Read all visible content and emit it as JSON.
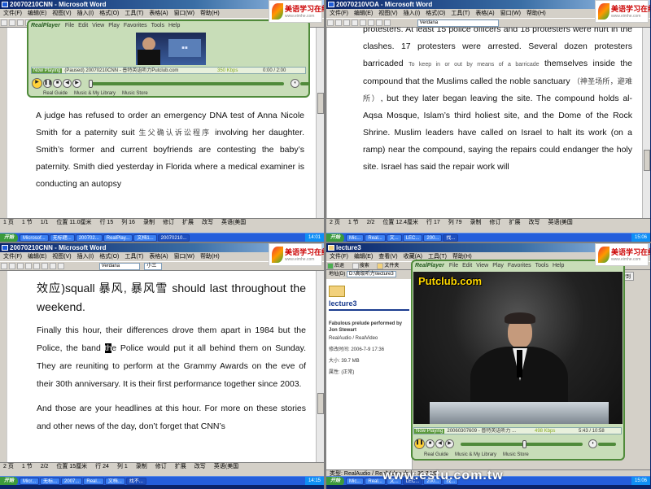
{
  "logo": {
    "text": "美语学习在线",
    "sub": "www.eimhe.com"
  },
  "windows": [
    {
      "title": "20070210CNN - Microsoft Word",
      "menus": [
        "文件(F)",
        "编辑(E)",
        "视图(V)",
        "插入(I)",
        "格式(O)",
        "工具(T)",
        "表格(A)",
        "窗口(W)",
        "帮助(H)"
      ],
      "player": {
        "brand": "RealPlayer",
        "menus": [
          "File",
          "Edit",
          "View",
          "Play",
          "Favorites",
          "Tools",
          "Help"
        ],
        "now_playing": "Now Playing",
        "clip": "(Paused) 20070210CNN - 普特英语听力Putclub.com",
        "bitrate": "350 Kbps",
        "time": "0:00 / 2:00",
        "progress_fraction": 0.0,
        "links": [
          "Real Guide",
          "Music & My Library",
          "Music Store"
        ]
      },
      "paragraphs": [
        "A judge has refused to order an emergency DNA test of Anna Nicole Smith for a paternity suit ",
        "生父确认诉讼程序",
        " involving her daughter. Smith’s former and current boyfriends are contesting the baby’s paternity. Smith died yesterday in Florida where a medical examiner is conducting an autopsy"
      ],
      "status": [
        "1 页",
        "1 节",
        "1/1",
        "位置 11.0厘米",
        "行 15",
        "列 16",
        "录制",
        "修订",
        "扩展",
        "改写",
        "英语(美国"
      ],
      "tasks": [
        "开始",
        "Microsof...",
        "无标题...",
        "200702...",
        "RealPlay...",
        "文档1...",
        "20070210..."
      ],
      "clock": "14:01"
    },
    {
      "title": "20070210VOA - Microsoft Word",
      "menus": [
        "文件(F)",
        "编辑(E)",
        "视图(V)",
        "插入(I)",
        "格式(O)",
        "工具(T)",
        "表格(A)",
        "窗口(W)",
        "帮助(H)"
      ],
      "font": "Verdana",
      "paragraphs": [
        "protesters. At least 15 police officers and 18 protesters were hurt in the clashes. 17 protesters were arrested. Several dozen protesters barricaded ",
        "To keep in or out by means of a barricade",
        " themselves inside the compound that the Muslims called the noble sanctuary ",
        "（神圣场所，避难所）",
        ", but they later began leaving the site. The compound holds al-Aqsa Mosque, Islam’s third holiest site, and the Dome of the Rock Shrine. Muslim leaders have called on Israel to halt its work (on a ramp) near the compound, saying the repairs could endanger the holy site. Israel has said the repair work will"
      ],
      "status": [
        "2 页",
        "1 节",
        "2/2",
        "位置 12.4厘米",
        "行 17",
        "列 79",
        "录制",
        "修订",
        "扩展",
        "改写",
        "英语(美国"
      ],
      "tasks": [
        "开始",
        "Mic...",
        "Real...",
        "文...",
        "LEC...",
        "200...",
        "找..."
      ],
      "clock": "15:06"
    },
    {
      "title": "20070210CNN - Microsoft Word",
      "menus": [
        "文件(F)",
        "编辑(E)",
        "视图(V)",
        "插入(I)",
        "格式(O)",
        "工具(T)",
        "表格(A)",
        "窗口(W)",
        "帮助(H)"
      ],
      "font": "Verdana",
      "size": "小三",
      "lines": [
        {
          "pre": "效应)squall 暴风, 暴风雪 should last throughout the weekend.",
          "big": true
        },
        {
          "pre": "Finally this hour, their differences drove them apart in 1984 but the Police, the band ",
          "sel": "th",
          "post": "e Police would put it all behind them on Sunday. They are reuniting to perform at the Grammy Awards on the eve of their 30th anniversary. It is their first performance together since 2003."
        },
        {
          "pre": "And those are your headlines at this hour. For more on these stories and other news of the day, don’t forget that CNN’s"
        }
      ],
      "status": [
        "2 页",
        "1 节",
        "2/2",
        "位置 15厘米",
        "行 24",
        "列 1",
        "录制",
        "修订",
        "扩展",
        "改写",
        "英语(美国"
      ],
      "tasks": [
        "开始",
        "Micr...",
        "无标...",
        "2007...",
        "Real...",
        "文档...",
        "找不..."
      ],
      "clock": "14:15"
    },
    {
      "title": "lecture3",
      "menus": [
        "文件(F)",
        "编辑(E)",
        "查看(V)",
        "收藏(A)",
        "工具(T)",
        "帮助(H)"
      ],
      "toolbar": [
        "后退",
        "搜索",
        "文件夹"
      ],
      "address_label": "地址(D)",
      "address": "D:\\高级听力\\lecture3",
      "go": "转到",
      "explorer": {
        "name": "lecture3",
        "desc": "Fabulous prelude performed by Jon Stewart",
        "type": "RealAudio / RealVideo",
        "modified": "修改时间: 2006-7-9 17:36",
        "size": "大小: 39.7 MB",
        "attr": "属性: (正常)"
      },
      "player": {
        "brand": "RealPlayer",
        "menus": [
          "File",
          "Edit",
          "View",
          "Play",
          "Favorites",
          "Tools",
          "Help"
        ],
        "overlay": "Putclub.com",
        "now_playing": "Now Playing",
        "clip": "20060307609 - 普特英语听力 ...",
        "bitrate": "498 Kbps",
        "time": "5:43 / 10:58",
        "progress_fraction": 0.52,
        "links": [
          "Real Guide",
          "Music & My Library",
          "Music Store"
        ]
      },
      "status": "类型: RealAudio / RealVideo 大小: 39.7 MB",
      "tasks": [
        "开始",
        "Mic...",
        "Real...",
        "文...",
        "LEC...",
        "200...",
        "找..."
      ],
      "clock": "15:06"
    }
  ],
  "watermark": "www.estu.com.tw"
}
